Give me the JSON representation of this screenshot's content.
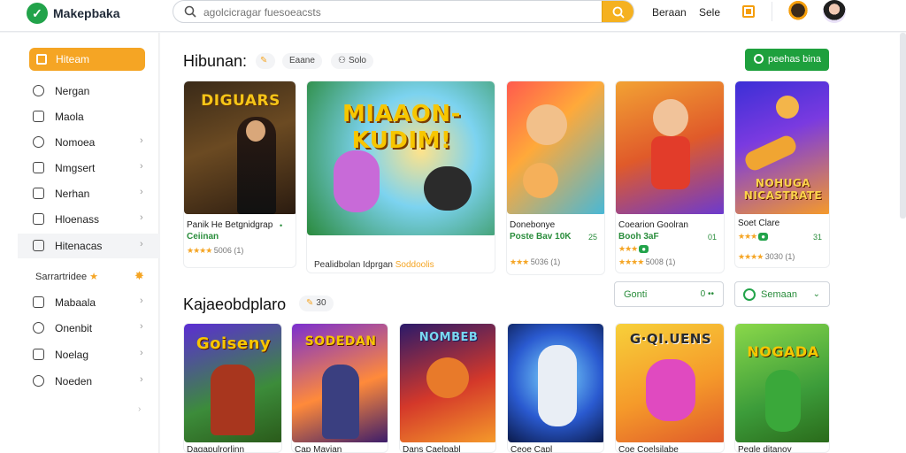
{
  "header": {
    "brand": "Makepbaka",
    "search_placeholder": "agolcicragar fuesoeacsts",
    "link1": "Beraan",
    "link2": "Sele"
  },
  "sidebar": {
    "active": "Hiteam",
    "items": [
      {
        "label": "Nergan",
        "chev": ""
      },
      {
        "label": "Maola",
        "chev": ""
      },
      {
        "label": "Nomoea",
        "chev": "›"
      },
      {
        "label": "Nmgsert",
        "chev": "›"
      },
      {
        "label": "Nerhan",
        "chev": "›"
      },
      {
        "label": "Hloenass",
        "chev": "›"
      },
      {
        "label": "Hitenacas",
        "chev": "›"
      }
    ],
    "section": "Sarrartridee",
    "items2": [
      {
        "label": "Mabaala",
        "chev": "›"
      },
      {
        "label": "Onenbit",
        "chev": "›"
      },
      {
        "label": "Noelag",
        "chev": "›"
      },
      {
        "label": "Noeden",
        "chev": "›"
      }
    ]
  },
  "main": {
    "section1_title": "Hibunan:",
    "chip1": "Eaane",
    "chip2": "Solo",
    "green_button": "peehas bina",
    "section2_title": "Kajaeobdplaro",
    "chip3": "30",
    "filter1": {
      "label": "Gonti",
      "right": "0 ••"
    },
    "filter2": {
      "label": "Semaan",
      "right": "⌄"
    },
    "row1": [
      {
        "art_title": "DIGUARS",
        "name": "Panik He Betgnidgrap",
        "sub": "Ceiinan",
        "meta": "5006 (1)",
        "right": "•"
      },
      {
        "art_title": "MIAAON-KUDIM!",
        "name": "Pealidbolan Idprgan",
        "sub": "",
        "meta": "Soddoolis",
        "right": ""
      },
      {
        "art_title": "",
        "name": "Donebonye",
        "sub": "Poste Bav 10K",
        "meta": "5036 (1)",
        "right": "25"
      },
      {
        "art_title": "",
        "name": "Coearion Goolran",
        "sub": "Booh 3aF",
        "meta": "5008 (1)",
        "right": "01"
      },
      {
        "art_title": "NOHUGA NICASTRATE",
        "name": "Soet Clare",
        "sub": "",
        "meta": "3030 (1)",
        "right": "31"
      }
    ],
    "row2": [
      {
        "art_title": "Goiseny"
      },
      {
        "art_title": "SODEDAN"
      },
      {
        "art_title": "NOMBEB"
      },
      {
        "art_title": ""
      },
      {
        "art_title": "G·QI.UENS"
      },
      {
        "art_title": "NOGADA"
      }
    ],
    "row2_names": [
      "Dagapulrorlinn",
      "Cap Mayian",
      "Dans Caelpabl",
      "Ceoe Capl",
      "Coe Coelsilabe",
      "Pegle ditanoy"
    ]
  }
}
